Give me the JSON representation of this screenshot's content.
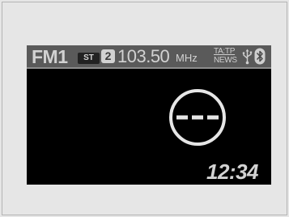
{
  "radio": {
    "band": "FM1",
    "stereo_badge": "ST",
    "preset_number": "2",
    "frequency": "103.50",
    "frequency_unit": "MHz",
    "ta_tp": "TA:TP",
    "news": "NEWS",
    "clock": "12:34"
  },
  "icons": {
    "usb": "usb-icon",
    "bluetooth": "bluetooth-icon",
    "no_signal": "no-signal-icon"
  },
  "colors": {
    "screen_background": "#000000",
    "status_bar": "#5a5a5a",
    "text": "#d2d2d2",
    "page_background": "#e6e6e6"
  }
}
